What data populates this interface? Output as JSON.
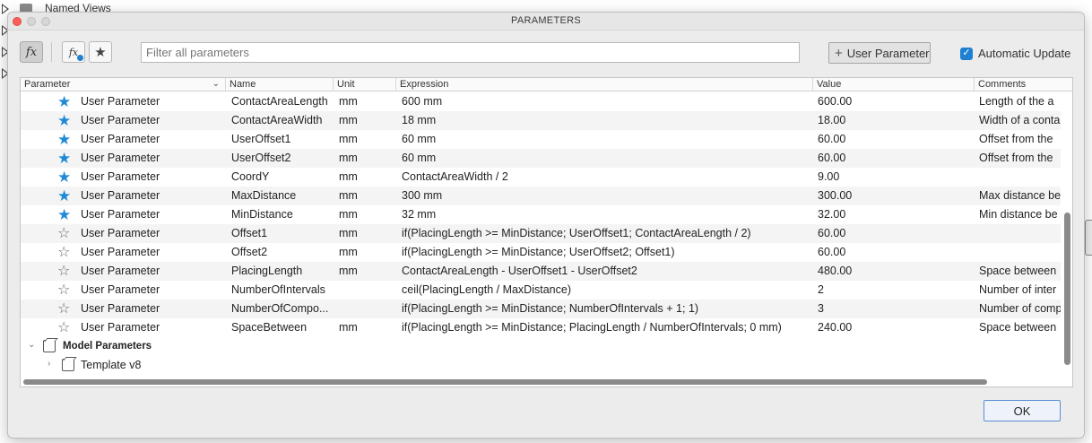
{
  "background": {
    "named_views_label": "Named Views"
  },
  "dialog": {
    "title": "PARAMETERS",
    "toolbar": {
      "all_parameters_icon": "fx-icon",
      "user_parameters_icon": "fx-user-icon",
      "favorites_icon": "star-icon",
      "search_placeholder": "Filter all parameters",
      "add_user_parameter_label": "User Parameter",
      "automatic_update_label": "Automatic Update",
      "automatic_update_checked": true
    },
    "table": {
      "columns": [
        "Parameter",
        "Name",
        "Unit",
        "Expression",
        "Value",
        "Comments"
      ],
      "rows": [
        {
          "favorite": true,
          "parameter": "User Parameter",
          "name": "ContactAreaLength",
          "unit": "mm",
          "expression": "600 mm",
          "value": "600.00",
          "comments": "Length of the a"
        },
        {
          "favorite": true,
          "parameter": "User Parameter",
          "name": "ContactAreaWidth",
          "unit": "mm",
          "expression": "18 mm",
          "value": "18.00",
          "comments": "Width of a conta"
        },
        {
          "favorite": true,
          "parameter": "User Parameter",
          "name": "UserOffset1",
          "unit": "mm",
          "expression": "60 mm",
          "value": "60.00",
          "comments": "Offset from the"
        },
        {
          "favorite": true,
          "parameter": "User Parameter",
          "name": "UserOffset2",
          "unit": "mm",
          "expression": "60 mm",
          "value": "60.00",
          "comments": "Offset from the"
        },
        {
          "favorite": true,
          "parameter": "User Parameter",
          "name": "CoordY",
          "unit": "mm",
          "expression": "ContactAreaWidth / 2",
          "value": "9.00",
          "comments": ""
        },
        {
          "favorite": true,
          "parameter": "User Parameter",
          "name": "MaxDistance",
          "unit": "mm",
          "expression": "300 mm",
          "value": "300.00",
          "comments": "Max distance be"
        },
        {
          "favorite": true,
          "parameter": "User Parameter",
          "name": "MinDistance",
          "unit": "mm",
          "expression": "32 mm",
          "value": "32.00",
          "comments": "Min distance be"
        },
        {
          "favorite": false,
          "parameter": "User Parameter",
          "name": "Offset1",
          "unit": "mm",
          "expression": "if(PlacingLength >= MinDistance; UserOffset1; ContactAreaLength / 2)",
          "value": "60.00",
          "comments": ""
        },
        {
          "favorite": false,
          "parameter": "User Parameter",
          "name": "Offset2",
          "unit": "mm",
          "expression": "if(PlacingLength >= MinDistance; UserOffset2; Offset1)",
          "value": "60.00",
          "comments": ""
        },
        {
          "favorite": false,
          "parameter": "User Parameter",
          "name": "PlacingLength",
          "unit": "mm",
          "expression": "ContactAreaLength - UserOffset1 - UserOffset2",
          "value": "480.00",
          "comments": "Space between"
        },
        {
          "favorite": false,
          "parameter": "User Parameter",
          "name": "NumberOfIntervals",
          "unit": "",
          "expression": "ceil(PlacingLength / MaxDistance)",
          "value": "2",
          "comments": "Number of inter"
        },
        {
          "favorite": false,
          "parameter": "User Parameter",
          "name": "NumberOfCompo...",
          "unit": "",
          "expression": "if(PlacingLength >= MinDistance; NumberOfIntervals + 1; 1)",
          "value": "3",
          "comments": "Number of comp"
        },
        {
          "favorite": false,
          "parameter": "User Parameter",
          "name": "SpaceBetween",
          "unit": "mm",
          "expression": "if(PlacingLength >= MinDistance; PlacingLength / NumberOfIntervals; 0 mm)",
          "value": "240.00",
          "comments": "Space between"
        }
      ],
      "groups": {
        "model_parameters": "Model Parameters",
        "template": "Template v8"
      }
    },
    "ok_label": "OK"
  },
  "colors": {
    "accent": "#1f8ad6",
    "close": "#fc5e55"
  }
}
